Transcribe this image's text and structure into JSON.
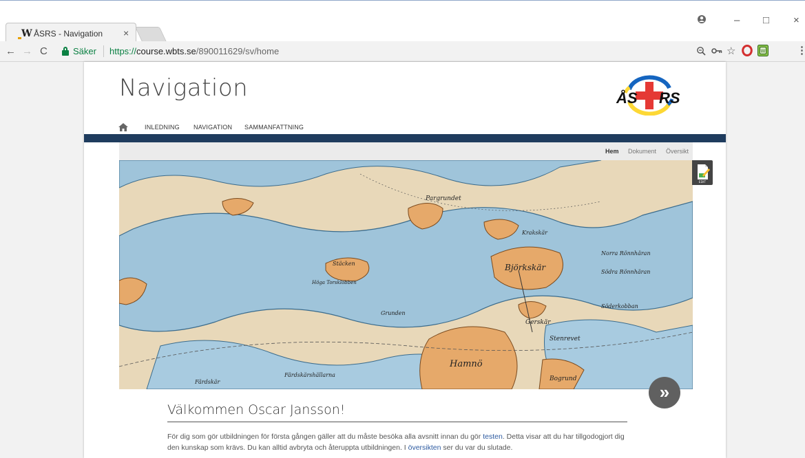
{
  "browser": {
    "tab_title": "ÅSRS - Navigation",
    "tab_favicon": "W",
    "tab_close": "×",
    "secure_label": "Säker",
    "url_scheme": "https://",
    "url_host": "course.wbts.se",
    "url_path": "/890011629/sv/home",
    "back_icon": "←",
    "forward_icon": "→",
    "reload_icon": "C",
    "window_controls": [
      "–",
      "□",
      "×"
    ],
    "toolbar_icons": [
      "zoom-icon",
      "key-icon",
      "star-icon",
      "opera-icon",
      "extension-icon",
      "menu-icon"
    ]
  },
  "site": {
    "title": "Navigation",
    "logo_text_left": "ÅS",
    "logo_text_right": "RS",
    "menu": [
      "INLEDNING",
      "NAVIGATION",
      "SAMMANFATTNING"
    ],
    "colors": {
      "bar": "#1f3c5e",
      "logo_red": "#e53935",
      "logo_blue": "#1565c0",
      "logo_yellow": "#fdd835",
      "link": "#2c5aa0"
    }
  },
  "subnav": [
    "Hem",
    "Dokument",
    "Översikt"
  ],
  "edit_label": "EDIT",
  "hero_labels": [
    "Pargrundet",
    "Krakskär",
    "Björkskär",
    "Norra Rönnhäran",
    "Södra Rönnhäran",
    "Söderkobban",
    "Gerskär",
    "Stenrevet",
    "Hamnö",
    "Bogrund",
    "Stäcken",
    "Höga Torsklobben",
    "Grunden",
    "Färdskär",
    "Färdskärshällarna"
  ],
  "next_icon": "»",
  "welcome": "Välkommen Oscar Jansson!",
  "intro": {
    "part1": "För dig som gör utbildningen för första gången gäller att du måste besöka alla avsnitt innan du gör ",
    "link1": "testen",
    "part2": ". Detta visar att du har tillgodogjort dig den kunskap som krävs. Du kan alltid avbryta och återuppta utbildningen. I ",
    "link2": "översikten",
    "part3": " ser du var du slutade."
  }
}
